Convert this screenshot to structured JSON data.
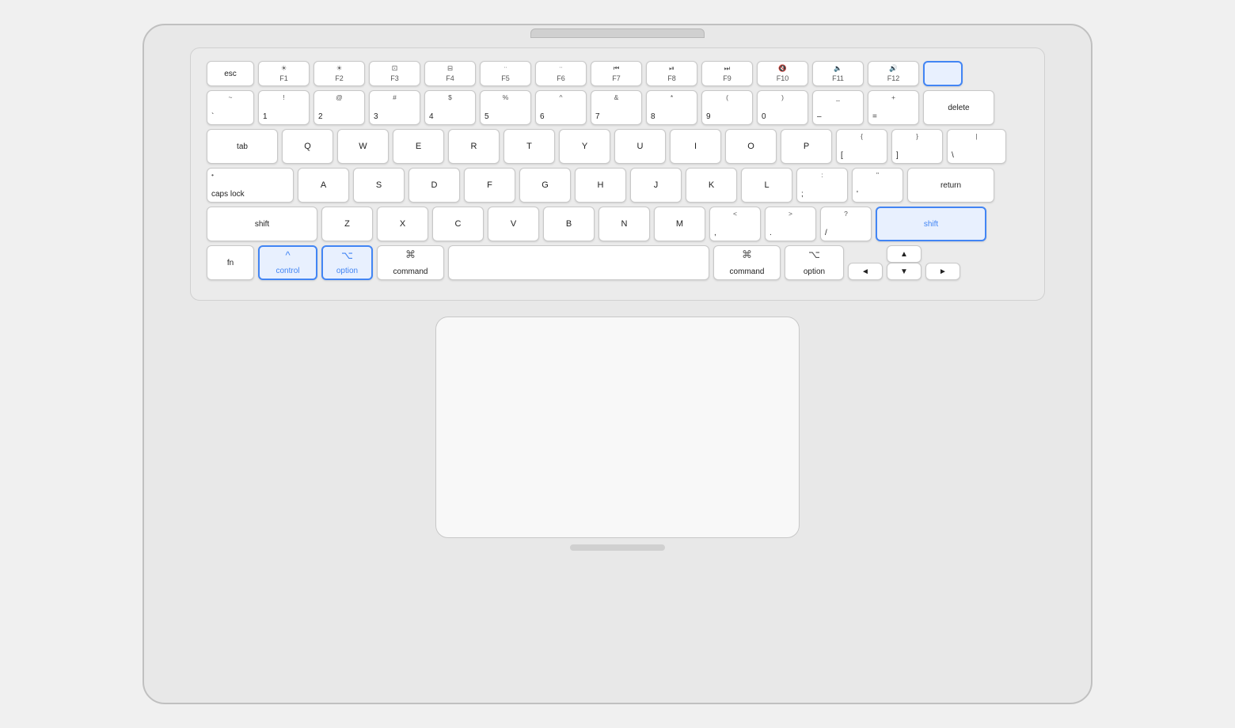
{
  "keyboard": {
    "rows": {
      "fn_row": [
        {
          "id": "esc",
          "label": "esc",
          "width": "w-60"
        },
        {
          "id": "f1",
          "top": "☀",
          "bottom": "F1",
          "width": "w-65"
        },
        {
          "id": "f2",
          "top": "☀",
          "bottom": "F2",
          "width": "w-65"
        },
        {
          "id": "f3",
          "top": "⊞",
          "bottom": "F3",
          "width": "w-65"
        },
        {
          "id": "f4",
          "top": "⊟",
          "bottom": "F4",
          "width": "w-65"
        },
        {
          "id": "f5",
          "top": "···",
          "bottom": "F5",
          "width": "w-65"
        },
        {
          "id": "f6",
          "top": "···",
          "bottom": "F6",
          "width": "w-65"
        },
        {
          "id": "f7",
          "top": "⏮",
          "bottom": "F7",
          "width": "w-65"
        },
        {
          "id": "f8",
          "top": "⏯",
          "bottom": "F8",
          "width": "w-65"
        },
        {
          "id": "f9",
          "top": "⏭",
          "bottom": "F9",
          "width": "w-65"
        },
        {
          "id": "f10",
          "top": "🔇",
          "bottom": "F10",
          "width": "w-65"
        },
        {
          "id": "f11",
          "top": "🔈",
          "bottom": "F11",
          "width": "w-65"
        },
        {
          "id": "f12",
          "top": "🔊",
          "bottom": "F12",
          "width": "w-65"
        },
        {
          "id": "power",
          "label": "",
          "width": "w-50",
          "highlighted": true
        }
      ],
      "number_row": [
        {
          "id": "tilde",
          "top": "~",
          "bottom": "`",
          "width": "w-60"
        },
        {
          "id": "1",
          "top": "!",
          "bottom": "1",
          "width": "w-65"
        },
        {
          "id": "2",
          "top": "@",
          "bottom": "2",
          "width": "w-65"
        },
        {
          "id": "3",
          "top": "#",
          "bottom": "3",
          "width": "w-65"
        },
        {
          "id": "4",
          "top": "$",
          "bottom": "4",
          "width": "w-65"
        },
        {
          "id": "5",
          "top": "%",
          "bottom": "5",
          "width": "w-65"
        },
        {
          "id": "6",
          "top": "^",
          "bottom": "6",
          "width": "w-65"
        },
        {
          "id": "7",
          "top": "&",
          "bottom": "7",
          "width": "w-65"
        },
        {
          "id": "8",
          "top": "*",
          "bottom": "8",
          "width": "w-65"
        },
        {
          "id": "9",
          "top": "(",
          "bottom": "9",
          "width": "w-65"
        },
        {
          "id": "0",
          "top": ")",
          "bottom": "0",
          "width": "w-65"
        },
        {
          "id": "minus",
          "top": "_",
          "bottom": "–",
          "width": "w-65"
        },
        {
          "id": "equals",
          "top": "+",
          "bottom": "=",
          "width": "w-65"
        },
        {
          "id": "delete",
          "label": "delete",
          "width": "w-90"
        }
      ],
      "tab_row": [
        {
          "id": "tab",
          "label": "tab",
          "width": "w-90"
        },
        {
          "id": "q",
          "label": "Q",
          "width": "w-65"
        },
        {
          "id": "w",
          "label": "W",
          "width": "w-65"
        },
        {
          "id": "e",
          "label": "E",
          "width": "w-65"
        },
        {
          "id": "r",
          "label": "R",
          "width": "w-65"
        },
        {
          "id": "t",
          "label": "T",
          "width": "w-65"
        },
        {
          "id": "y",
          "label": "Y",
          "width": "w-65"
        },
        {
          "id": "u",
          "label": "U",
          "width": "w-65"
        },
        {
          "id": "i",
          "label": "I",
          "width": "w-65"
        },
        {
          "id": "o",
          "label": "O",
          "width": "w-65"
        },
        {
          "id": "p",
          "label": "P",
          "width": "w-65"
        },
        {
          "id": "lbracket",
          "top": "{",
          "bottom": "[",
          "width": "w-65"
        },
        {
          "id": "rbracket",
          "top": "}",
          "bottom": "]",
          "width": "w-65"
        },
        {
          "id": "backslash",
          "top": "|",
          "bottom": "\\",
          "width": "w-75"
        }
      ],
      "caps_row": [
        {
          "id": "capslock",
          "top": "•",
          "bottom": "caps lock",
          "width": "w-110"
        },
        {
          "id": "a",
          "label": "A",
          "width": "w-65"
        },
        {
          "id": "s",
          "label": "S",
          "width": "w-65"
        },
        {
          "id": "d",
          "label": "D",
          "width": "w-65"
        },
        {
          "id": "f",
          "label": "F",
          "width": "w-65"
        },
        {
          "id": "g",
          "label": "G",
          "width": "w-65"
        },
        {
          "id": "h",
          "label": "H",
          "width": "w-65"
        },
        {
          "id": "j",
          "label": "J",
          "width": "w-65"
        },
        {
          "id": "k",
          "label": "K",
          "width": "w-65"
        },
        {
          "id": "l",
          "label": "L",
          "width": "w-65"
        },
        {
          "id": "semicolon",
          "top": ":",
          "bottom": ";",
          "width": "w-65"
        },
        {
          "id": "quote",
          "top": "\"",
          "bottom": "'",
          "width": "w-65"
        },
        {
          "id": "return",
          "label": "return",
          "width": "w-110"
        }
      ],
      "shift_row": [
        {
          "id": "shift_l",
          "label": "shift",
          "width": "w-140"
        },
        {
          "id": "z",
          "label": "Z",
          "width": "w-65"
        },
        {
          "id": "x",
          "label": "X",
          "width": "w-65"
        },
        {
          "id": "c",
          "label": "C",
          "width": "w-65"
        },
        {
          "id": "v",
          "label": "V",
          "width": "w-65"
        },
        {
          "id": "b",
          "label": "B",
          "width": "w-65"
        },
        {
          "id": "n",
          "label": "N",
          "width": "w-65"
        },
        {
          "id": "m",
          "label": "M",
          "width": "w-65"
        },
        {
          "id": "comma",
          "top": "<",
          "bottom": ",",
          "width": "w-65"
        },
        {
          "id": "period",
          "top": ">",
          "bottom": ".",
          "width": "w-65"
        },
        {
          "id": "slash",
          "top": "?",
          "bottom": "/",
          "width": "w-65"
        },
        {
          "id": "shift_r",
          "label": "shift",
          "width": "w-140",
          "highlighted": true
        }
      ],
      "bottom_row": [
        {
          "id": "fn",
          "label": "fn",
          "width": "w-60"
        },
        {
          "id": "control",
          "top": "^",
          "bottom": "control",
          "width": "w-75",
          "highlighted": true
        },
        {
          "id": "option_l",
          "top": "⌥",
          "bottom": "option",
          "width": "w-65",
          "highlighted": true
        },
        {
          "id": "command_l",
          "top": "⌘",
          "bottom": "command",
          "width": "w-85"
        },
        {
          "id": "space",
          "label": "",
          "width": "w-330"
        },
        {
          "id": "command_r",
          "top": "⌘",
          "bottom": "command",
          "width": "w-85"
        },
        {
          "id": "option_r",
          "top": "⌥",
          "bottom": "option",
          "width": "w-75"
        }
      ]
    }
  }
}
